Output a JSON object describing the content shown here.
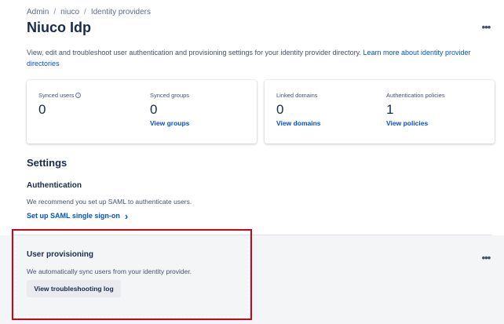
{
  "breadcrumb": [
    "Admin",
    "niuco",
    "Identity providers"
  ],
  "breadcrumb_sep": "/",
  "page": {
    "title": "Niuco Idp",
    "more_label": "•••",
    "description": "View, edit and troubleshoot user authentication and provisioning settings for your identity provider directory.",
    "learn_more": "Learn more about identity provider directories"
  },
  "stats": {
    "synced_users": {
      "label": "Synced users",
      "value": "0"
    },
    "synced_groups": {
      "label": "Synced groups",
      "value": "0",
      "link": "View groups"
    },
    "linked_domains": {
      "label": "Linked domains",
      "value": "0",
      "link": "View domains"
    },
    "auth_policies": {
      "label": "Authentication policies",
      "value": "1",
      "link": "View policies"
    }
  },
  "settings": {
    "title": "Settings",
    "authentication": {
      "title": "Authentication",
      "text": "We recommend you set up SAML to authenticate users.",
      "link": "Set up SAML single sign-on",
      "chevron": "›"
    },
    "provisioning": {
      "title": "User provisioning",
      "text": "We automatically sync users from your identity provider.",
      "button": "View troubleshooting log",
      "more_label": "•••"
    }
  },
  "colors": {
    "accent": "#0052cc",
    "highlight": "#d0021b"
  }
}
